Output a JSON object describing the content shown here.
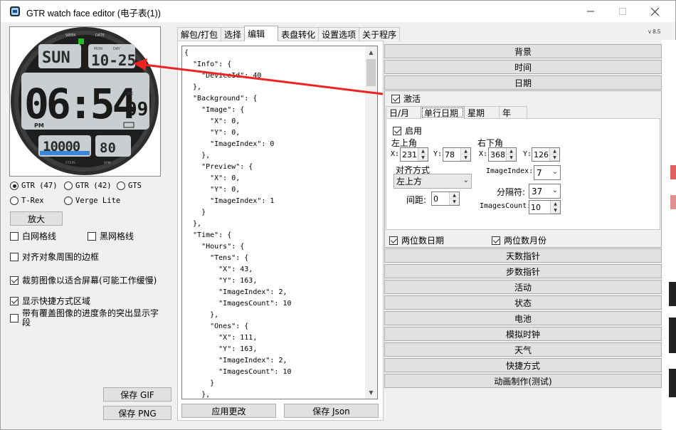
{
  "window": {
    "title": "GTR watch face editor (电子表(1))",
    "version": "v 8.5"
  },
  "preview": {
    "week": "WEEK",
    "date_label": "DATE",
    "day_text": "SUN",
    "mon_label": "MON",
    "day_label": "DAY",
    "date_text": "10-25",
    "time_text": "06:54",
    "sec_label": "SEC",
    "sec_text": "09",
    "pm": "PM",
    "steps": "10000",
    "bpm": "80",
    "steps_label": "STEPS",
    "bpm_label": "BPM"
  },
  "models": [
    {
      "label": "GTR (47)",
      "checked": true
    },
    {
      "label": "GTR (42)",
      "checked": false
    },
    {
      "label": "GTS",
      "checked": false
    },
    {
      "label": "T-Rex",
      "checked": false
    },
    {
      "label": "Verge Lite",
      "checked": false
    }
  ],
  "left": {
    "zoom_button": "放大",
    "white_grid": "白网格线",
    "black_grid": "黑网格线",
    "object_border": "对齐对象周围的边框",
    "crop_image": "裁剪图像以适合屏幕(可能工作缓慢)",
    "shortcuts": "显示快捷方式区域",
    "highlight": "带有覆盖图像的进度条的突出显示字段",
    "save_gif": "保存 GIF",
    "save_png": "保存 PNG"
  },
  "tabs": [
    "解包/打包",
    "选择",
    "编辑",
    "表盘转化",
    "设置选项",
    "关于程序"
  ],
  "json_text": "{\n  \"Info\": {\n    \"DeviceId\": 40\n  },\n  \"Background\": {\n    \"Image\": {\n      \"X\": 0,\n      \"Y\": 0,\n      \"ImageIndex\": 0\n    },\n    \"Preview\": {\n      \"X\": 0,\n      \"Y\": 0,\n      \"ImageIndex\": 1\n    }\n  },\n  \"Time\": {\n    \"Hours\": {\n      \"Tens\": {\n        \"X\": 43,\n        \"Y\": 163,\n        \"ImageIndex\": 2,\n        \"ImagesCount\": 10\n      },\n      \"Ones\": {\n        \"X\": 111,\n        \"Y\": 163,\n        \"ImageIndex\": 2,\n        \"ImagesCount\": 10\n      }\n    },",
  "bottom_buttons": {
    "apply": "应用更改",
    "save_json": "保存 Json"
  },
  "sections_top": [
    "背景",
    "时间",
    "日期"
  ],
  "date": {
    "activate": "激活",
    "subtabs": [
      "日/月",
      "单行日期",
      "星期",
      "年"
    ],
    "enable": "启用",
    "top_left": "左上角",
    "bottom_right": "右下角",
    "x1": "231",
    "y1": "78",
    "x2": "368",
    "y2": "126",
    "align_label": "对齐方式",
    "align_value": "左上方",
    "spacing_label": "间距:",
    "spacing_value": "0",
    "image_index_label": "ImageIndex:",
    "image_index_value": "7",
    "separator_label": "分隔符:",
    "separator_value": "37",
    "images_count_label": "ImagesCount:",
    "images_count_value": "10",
    "two_digit_day": "两位数日期",
    "two_digit_month": "两位数月份"
  },
  "sections_bottom": [
    "天数指针",
    "步数指针",
    "活动",
    "状态",
    "电池",
    "模拟时钟",
    "天气",
    "快捷方式",
    "动画制作(测试)"
  ],
  "colors": {
    "accent_arrow": "#ee2222",
    "watch_lcd": "#c9cfd1",
    "steps_blue": "#3a86d8",
    "green_indicator": "#22c022"
  }
}
